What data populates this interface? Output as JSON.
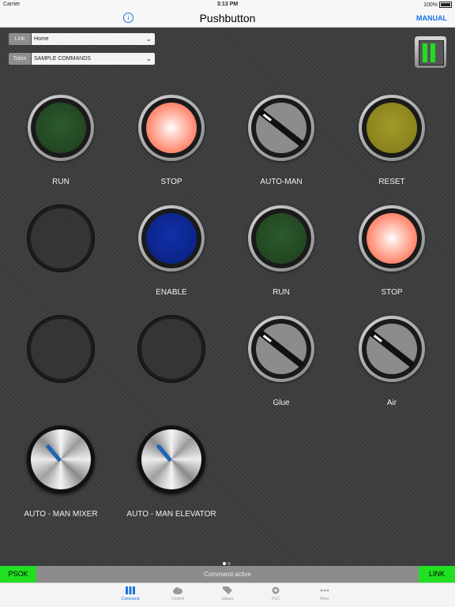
{
  "status_bar": {
    "carrier": "Carrier",
    "time": "3:13 PM",
    "battery": "100%"
  },
  "nav": {
    "title": "Pushbutton",
    "right_button": "MANUAL",
    "info_icon": "info-icon"
  },
  "selectors": {
    "link": {
      "label": "Link",
      "value": "Home"
    },
    "table": {
      "label": "Table",
      "value": "SAMPLE COMMANDS"
    }
  },
  "buttons": [
    {
      "label": "RUN",
      "kind": "lamp",
      "color": "#2d5a2d"
    },
    {
      "label": "STOP",
      "kind": "lamp",
      "color": "#ff8c74"
    },
    {
      "label": "AUTO-MAN",
      "kind": "selector"
    },
    {
      "label": "RESET",
      "kind": "lamp",
      "color": "#a29a2a"
    },
    {
      "label": "",
      "kind": "empty"
    },
    {
      "label": "ENABLE",
      "kind": "lamp",
      "color": "#1030a8"
    },
    {
      "label": "RUN",
      "kind": "lamp",
      "color": "#2d5a2d"
    },
    {
      "label": "STOP",
      "kind": "lamp",
      "color": "#ff8c74"
    },
    {
      "label": "",
      "kind": "empty"
    },
    {
      "label": "",
      "kind": "empty"
    },
    {
      "label": "Glue",
      "kind": "selector"
    },
    {
      "label": "Air",
      "kind": "selector"
    },
    {
      "label": "AUTO - MAN MIXER",
      "kind": "knob"
    },
    {
      "label": "AUTO - MAN ELEVATOR",
      "kind": "knob"
    }
  ],
  "page_indicator": {
    "pages": 2,
    "current": 1
  },
  "command_bar": {
    "left": "PSOK",
    "status": "Command active",
    "right": "LINK"
  },
  "tabs": [
    {
      "label": "Command",
      "icon": "command-icon",
      "active": true
    },
    {
      "label": "Control",
      "icon": "cloud-icon",
      "active": false
    },
    {
      "label": "Values",
      "icon": "tag-icon",
      "active": false
    },
    {
      "label": "PLC",
      "icon": "gear-icon",
      "active": false
    },
    {
      "label": "More",
      "icon": "more-icon",
      "active": false
    }
  ],
  "colors": {
    "accent": "#1a73e8",
    "ok_green": "#21e021"
  }
}
